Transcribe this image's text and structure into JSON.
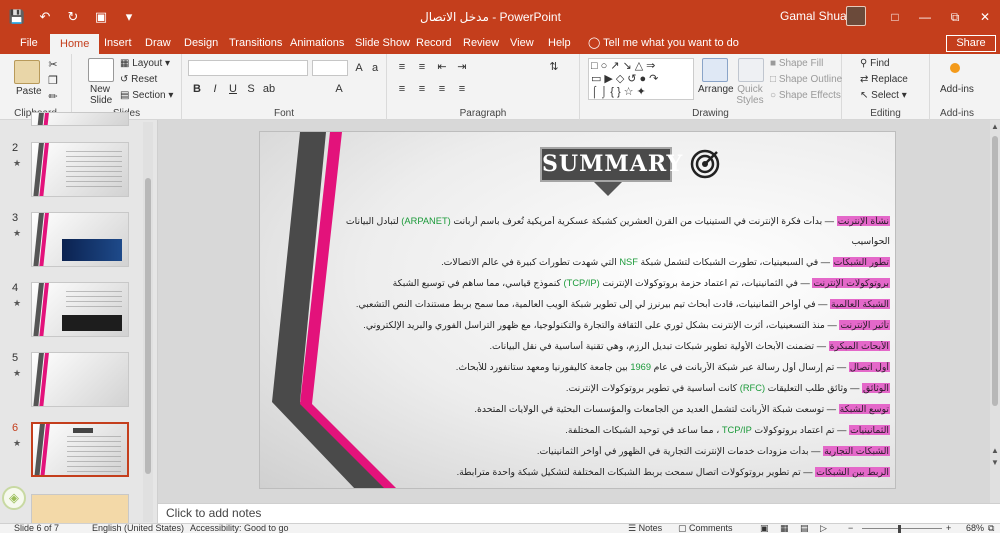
{
  "window": {
    "title": "مدخل الاتصال  -  PowerPoint",
    "user": "Gamal Shuayb",
    "qat": [
      "save-icon",
      "undo-icon",
      "redo-icon",
      "present-icon",
      "customize-icon"
    ]
  },
  "tabs": [
    "File",
    "Home",
    "Insert",
    "Draw",
    "Design",
    "Transitions",
    "Animations",
    "Slide Show",
    "Record",
    "Review",
    "View",
    "Help"
  ],
  "tell_me": "Tell me what you want to do",
  "share": "Share",
  "ribbon": {
    "clipboard": {
      "label": "Clipboard",
      "paste": "Paste"
    },
    "slides": {
      "label": "Slides",
      "new_slide": "New Slide",
      "layout": "Layout",
      "reset": "Reset",
      "section": "Section"
    },
    "font": {
      "label": "Font"
    },
    "paragraph": {
      "label": "Paragraph"
    },
    "drawing": {
      "label": "Drawing",
      "arrange": "Arrange",
      "quick_styles": "Quick Styles",
      "shape_fill": "Shape Fill",
      "shape_outline": "Shape Outline",
      "shape_effects": "Shape Effects"
    },
    "editing": {
      "label": "Editing",
      "find": "Find",
      "replace": "Replace",
      "select": "Select"
    },
    "addins": {
      "label": "Add-ins",
      "addins_btn": "Add-ins"
    }
  },
  "thumbnails": [
    {
      "num": "2"
    },
    {
      "num": "3"
    },
    {
      "num": "4"
    },
    {
      "num": "5"
    },
    {
      "num": "6"
    }
  ],
  "slide": {
    "heading": "SUMMARY",
    "rows": [
      {
        "label": "نشأة الإنترنت",
        "text": "— بدأت فكرة الإنترنت في الستينيات من القرن العشرين كشبكة عسكرية أمريكية تُعرف باسم أربانت",
        "accent": "(ARPANET)",
        "tail": "لتبادل البيانات"
      },
      {
        "label": "",
        "text": "الحواسيب",
        "accent": "",
        "tail": ""
      },
      {
        "label": "تطور الشبكات",
        "text": "— في السبعينيات، تطورت الشبكات لتشمل شبكة",
        "accent": "NSF",
        "tail": "التي شهدت تطورات كبيرة في عالم الاتصالات."
      },
      {
        "label": "بروتوكولات الإنترنت",
        "text": "— في الثمانينيات، تم اعتماد حزمة بروتوكولات الإنترنت",
        "accent": "(TCP/IP)",
        "tail": "كنموذج قياسي، مما ساهم في توسيع الشبكة"
      },
      {
        "label": "الشبكة العالمية",
        "text": "— في أواخر الثمانينيات، قادت أبحاث تيم بيرنرز لي إلى تطوير شبكة الويب العالمية، مما سمح بربط مستندات النص التشعبي.",
        "accent": "",
        "tail": ""
      },
      {
        "label": "تأثير الإنترنت",
        "text": "— منذ التسعينيات، أثرت الإنترنت بشكل ثوري على الثقافة والتجارة والتكنولوجيا، مع ظهور التراسل الفوري والبريد الإلكتروني.",
        "accent": "",
        "tail": ""
      },
      {
        "label": "الأبحاث المبكرة",
        "text": "— تضمنت الأبحاث الأولية تطوير شبكات تبديل الرزم، وهي تقنية أساسية في نقل البيانات.",
        "accent": "",
        "tail": ""
      },
      {
        "label": "أول اتصال",
        "text": "— تم إرسال أول رسالة عبر شبكة الأربانت في عام",
        "accent": "1969",
        "tail": "بين جامعة كاليفورنيا ومعهد ستانفورد للأبحاث."
      },
      {
        "label": "الوثائق",
        "text": "— وثائق طلب التعليقات",
        "accent": "(RFC)",
        "tail": "كانت أساسية في تطوير بروتوكولات الإنترنت."
      },
      {
        "label": "توسع الشبكة",
        "text": "— توسعت شبكة الأربانت لتشمل العديد من الجامعات والمؤسسات البحثية في الولايات المتحدة.",
        "accent": "",
        "tail": ""
      },
      {
        "label": "الثمانينيات",
        "text": "— تم اعتماد بروتوكولات",
        "accent": "TCP/IP",
        "tail": "، مما ساعد في توحيد الشبكات المختلفة."
      },
      {
        "label": "الشبكات التجارية",
        "text": "— بدأت مزودات خدمات الإنترنت التجارية في الظهور في أواخر الثمانينيات.",
        "accent": "",
        "tail": ""
      },
      {
        "label": "الربط بين الشبكات",
        "text": "— تم تطوير بروتوكولات اتصال سمحت بربط الشبكات المختلفة لتشكيل شبكة واحدة مترابطة.",
        "accent": "",
        "tail": ""
      }
    ]
  },
  "notes_placeholder": "Click to add notes",
  "status": {
    "slide_of": "Slide 6 of 7",
    "language": "English (United States)",
    "accessibility": "Accessibility: Good to go",
    "notes": "Notes",
    "comments": "Comments",
    "zoom": "68%"
  }
}
